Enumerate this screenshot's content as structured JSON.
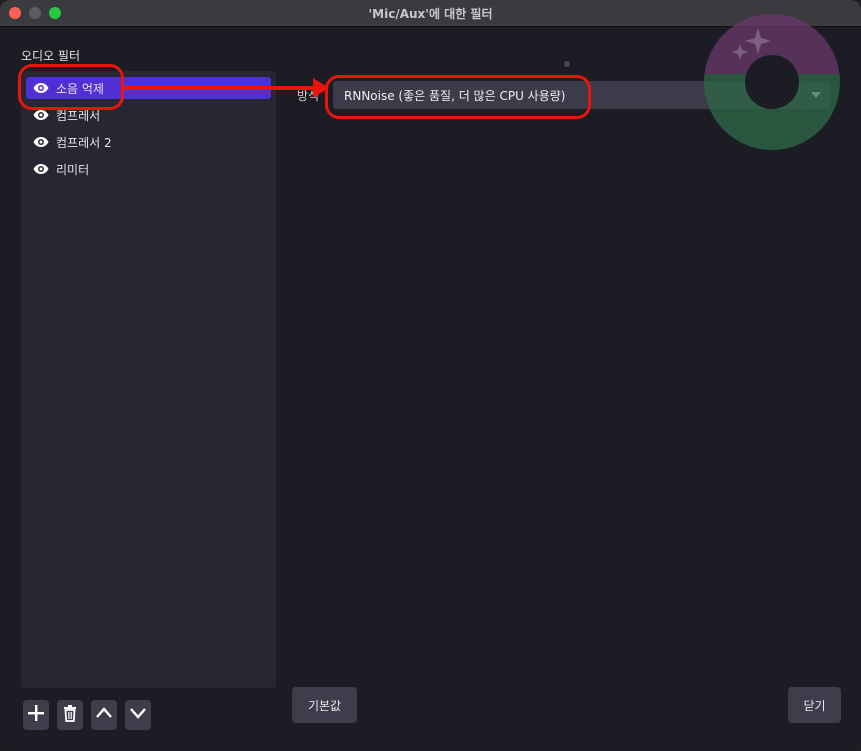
{
  "window": {
    "title": "'Mic/Aux'에 대한 필터"
  },
  "filters_panel": {
    "label": "오디오 필터",
    "items": [
      {
        "label": "소음 억제",
        "selected": true
      },
      {
        "label": "컴프레서",
        "selected": false
      },
      {
        "label": "컴프레서 2",
        "selected": false
      },
      {
        "label": "리미터",
        "selected": false
      }
    ]
  },
  "properties": {
    "method_label": "방식",
    "method_value": "RNNoise (좋은 품질, 더 많은 CPU 사용량)"
  },
  "buttons": {
    "defaults_label": "기본값",
    "close_label": "닫기"
  },
  "colors": {
    "accent": "#4f2fd6",
    "annotation": "#e8150c"
  },
  "icons": {
    "visibility": "eye-icon",
    "add": "plus-icon",
    "remove": "trash-icon",
    "move_up": "chevron-up-icon",
    "move_down": "chevron-down-icon",
    "dropdown": "dropdown-arrow-icon"
  }
}
